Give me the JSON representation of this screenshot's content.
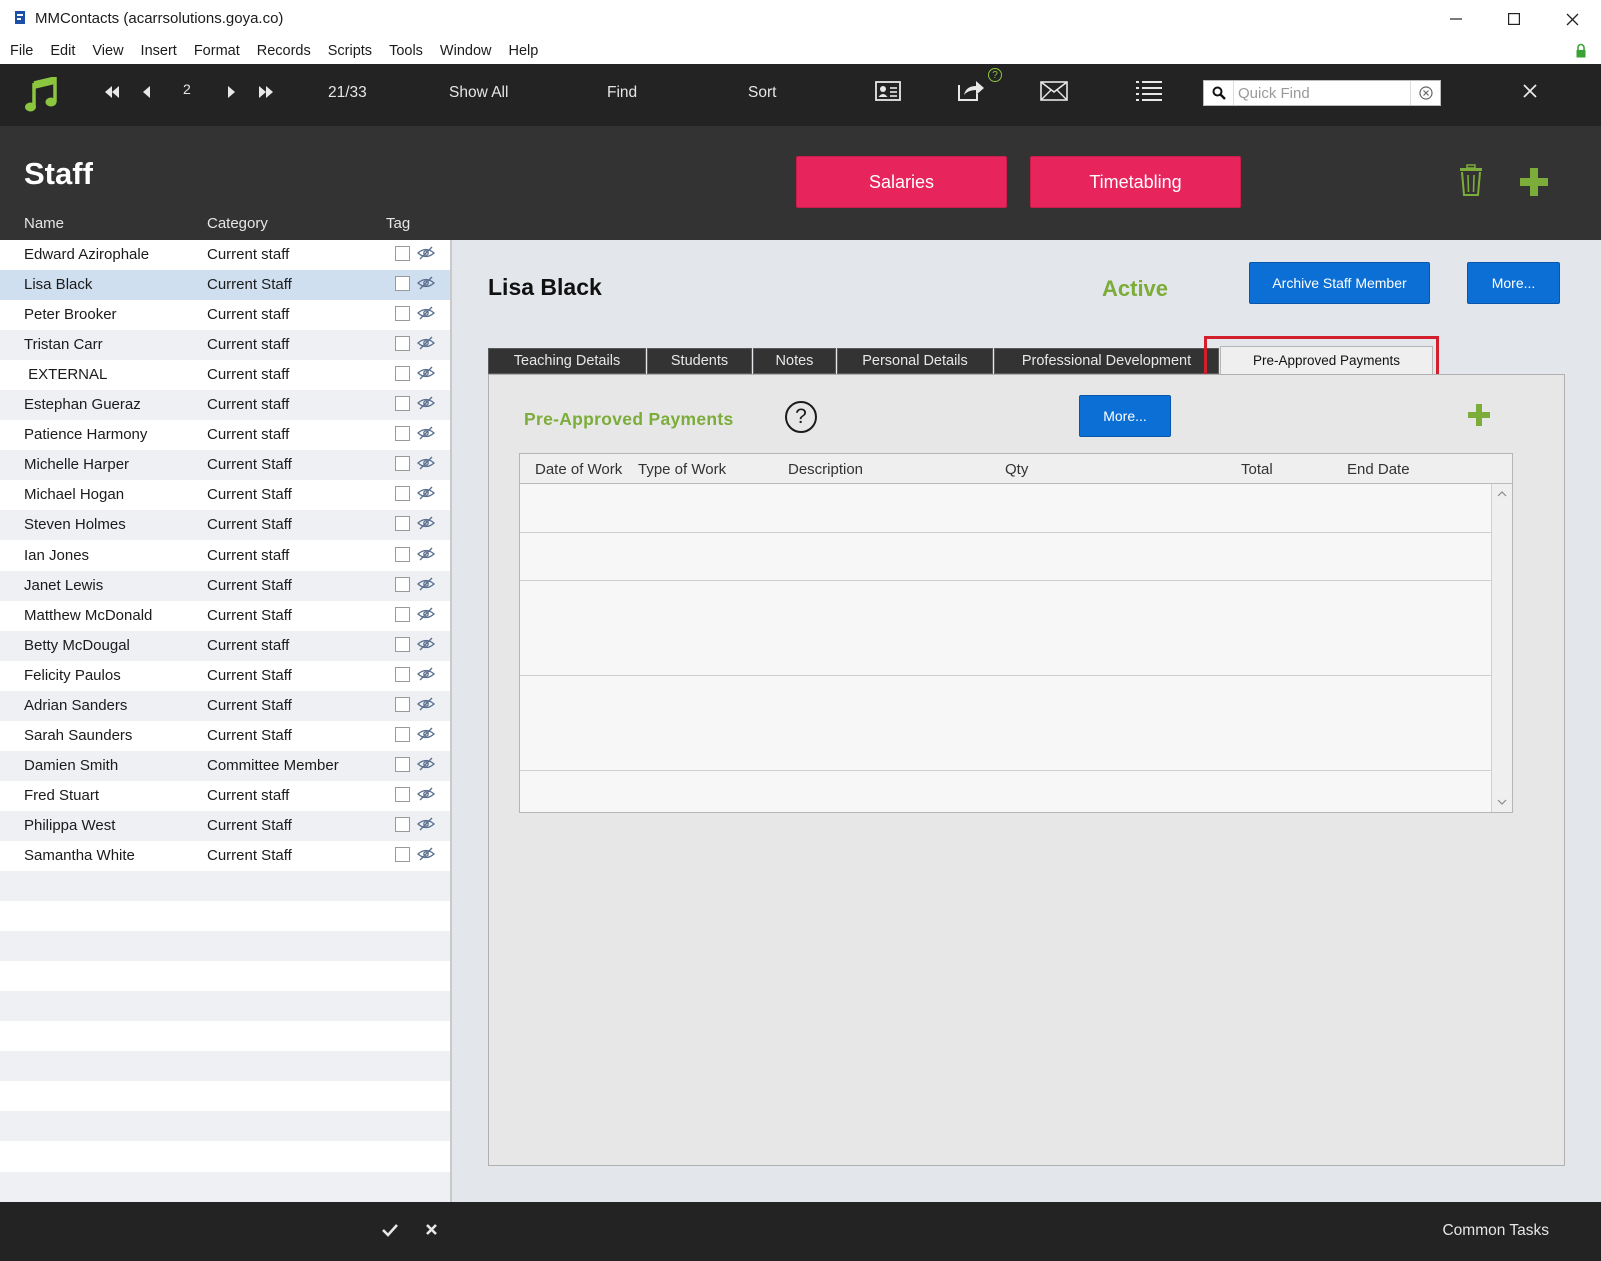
{
  "window": {
    "title": "MMContacts (acarrsolutions.goya.co)"
  },
  "menu": [
    "File",
    "Edit",
    "View",
    "Insert",
    "Format",
    "Records",
    "Scripts",
    "Tools",
    "Window",
    "Help"
  ],
  "toolbar": {
    "record_number": "2",
    "record_count": "21/33",
    "show_all": "Show All",
    "find": "Find",
    "sort": "Sort",
    "quick_find_placeholder": "Quick Find",
    "help_badge": "?"
  },
  "header": {
    "title": "Staff",
    "salaries_label": "Salaries",
    "timetabling_label": "Timetabling",
    "columns": {
      "name": "Name",
      "category": "Category",
      "tag": "Tag"
    }
  },
  "staff_list": [
    {
      "name": "Edward Azirophale",
      "category": "Current staff"
    },
    {
      "name": "Lisa Black",
      "category": "Current Staff",
      "selected": true
    },
    {
      "name": "Peter Brooker",
      "category": "Current staff"
    },
    {
      "name": "Tristan Carr",
      "category": "Current staff"
    },
    {
      "name": " EXTERNAL",
      "category": "Current staff"
    },
    {
      "name": "Estephan Gueraz",
      "category": "Current staff"
    },
    {
      "name": "Patience Harmony",
      "category": "Current staff"
    },
    {
      "name": "Michelle Harper",
      "category": "Current Staff"
    },
    {
      "name": "Michael Hogan",
      "category": "Current Staff"
    },
    {
      "name": "Steven Holmes",
      "category": "Current Staff"
    },
    {
      "name": "Ian Jones",
      "category": "Current staff"
    },
    {
      "name": "Janet Lewis",
      "category": "Current Staff"
    },
    {
      "name": "Matthew McDonald",
      "category": "Current Staff"
    },
    {
      "name": "Betty McDougal",
      "category": "Current staff"
    },
    {
      "name": "Felicity Paulos",
      "category": "Current Staff"
    },
    {
      "name": "Adrian Sanders",
      "category": "Current Staff"
    },
    {
      "name": "Sarah Saunders",
      "category": "Current Staff"
    },
    {
      "name": "Damien Smith",
      "category": "Committee Member"
    },
    {
      "name": "Fred Stuart",
      "category": "Current staff"
    },
    {
      "name": "Philippa West",
      "category": "Current Staff"
    },
    {
      "name": "Samantha White",
      "category": "Current Staff"
    }
  ],
  "detail": {
    "name": "Lisa Black",
    "status": "Active",
    "archive_label": "Archive Staff Member",
    "more_label": "More...",
    "tabs": [
      "Teaching Details",
      "Students",
      "Notes",
      "Personal Details",
      "Professional Development",
      "Pre-Approved Payments"
    ],
    "selected_tab": "Pre-Approved Payments"
  },
  "payments": {
    "title": "Pre-Approved Payments",
    "help": "?",
    "more_label": "More...",
    "columns": [
      "Date of Work",
      "Type of Work",
      "Description",
      "Qty",
      "Total",
      "End Date"
    ],
    "rows": []
  },
  "status_bar": {
    "common_tasks": "Common Tasks"
  },
  "colors": {
    "toolbar_bg": "#232323",
    "header_bg": "#333333",
    "accent_pink": "#e8245c",
    "accent_blue": "#0b6fd6",
    "status_green": "#7cac3a",
    "highlight_red": "#d21f2b"
  }
}
